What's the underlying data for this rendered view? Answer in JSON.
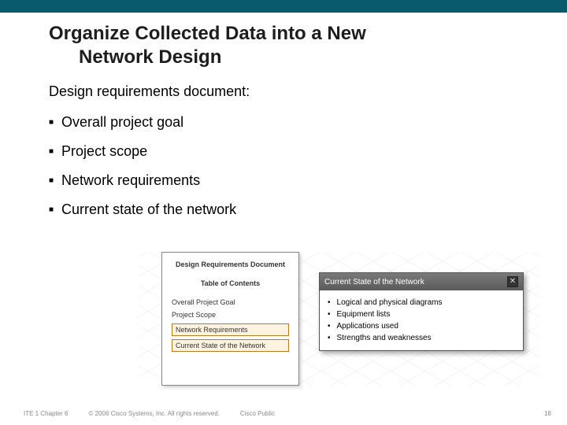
{
  "title_line1": "Organize Collected Data into a New",
  "title_line2": "Network Design",
  "subtitle": "Design requirements document:",
  "bullets": [
    "Overall project goal",
    "Project scope",
    "Network requirements",
    "Current state of the network"
  ],
  "doc_panel": {
    "title": "Design Requirements Document",
    "toc": "Table of Contents",
    "items": [
      "Overall Project Goal",
      "Project Scope"
    ],
    "boxed": [
      "Network Requirements",
      "Current State of the Network"
    ]
  },
  "popup": {
    "header": "Current State of the Network",
    "close": "✕",
    "items": [
      "Logical and physical diagrams",
      "Equipment lists",
      "Applications used",
      "Strengths and weaknesses"
    ]
  },
  "footer": {
    "left": "ITE 1 Chapter 6",
    "copyright": "© 2006 Cisco Systems, Inc. All rights reserved.",
    "public": "Cisco Public",
    "page": "18"
  }
}
